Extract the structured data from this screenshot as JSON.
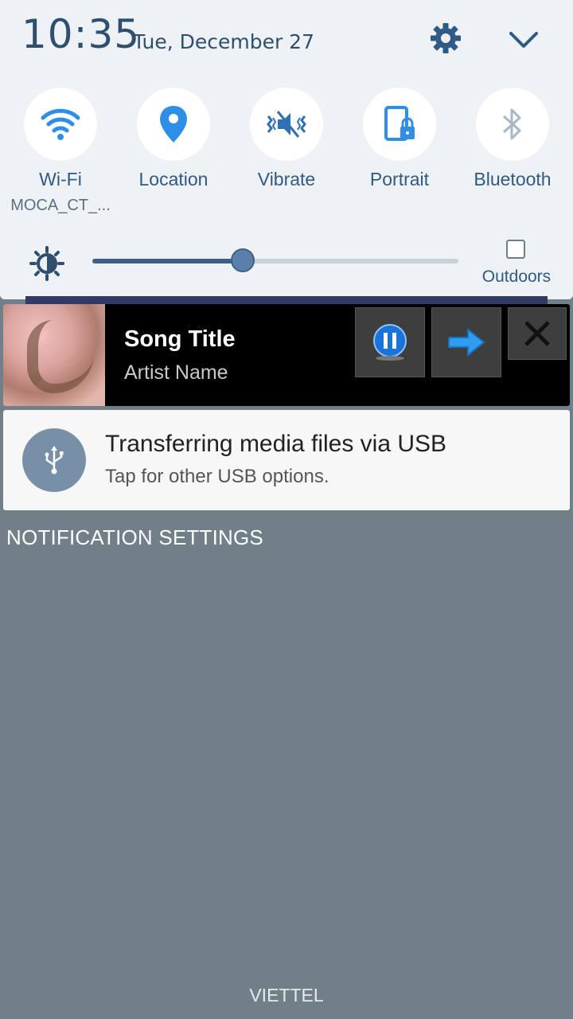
{
  "header": {
    "time": "10:35",
    "date": "Tue, December 27",
    "settings_icon": "gear-icon",
    "collapse_icon": "chevron-down-icon"
  },
  "quick_settings": [
    {
      "label": "Wi-Fi",
      "sub": "MOCA_CT_...",
      "icon": "wifi-icon"
    },
    {
      "label": "Location",
      "sub": "",
      "icon": "location-pin-icon"
    },
    {
      "label": "Vibrate",
      "sub": "",
      "icon": "vibrate-icon"
    },
    {
      "label": "Portrait",
      "sub": "",
      "icon": "portrait-lock-icon"
    },
    {
      "label": "Bluetooth",
      "sub": "",
      "icon": "bluetooth-icon"
    }
  ],
  "brightness": {
    "level_percent": 41,
    "outdoors_label": "Outdoors",
    "outdoors_checked": false
  },
  "music": {
    "title": "Song Title",
    "artist": "Artist Name"
  },
  "usb": {
    "title": "Transferring media files via USB",
    "subtitle": "Tap for other USB options."
  },
  "notification_settings_label": "NOTIFICATION SETTINGS",
  "carrier": "VIETTEL",
  "colors": {
    "panel_bg": "#eff2f5",
    "accent": "#2e5a83",
    "shade_bg": "#717f89"
  }
}
